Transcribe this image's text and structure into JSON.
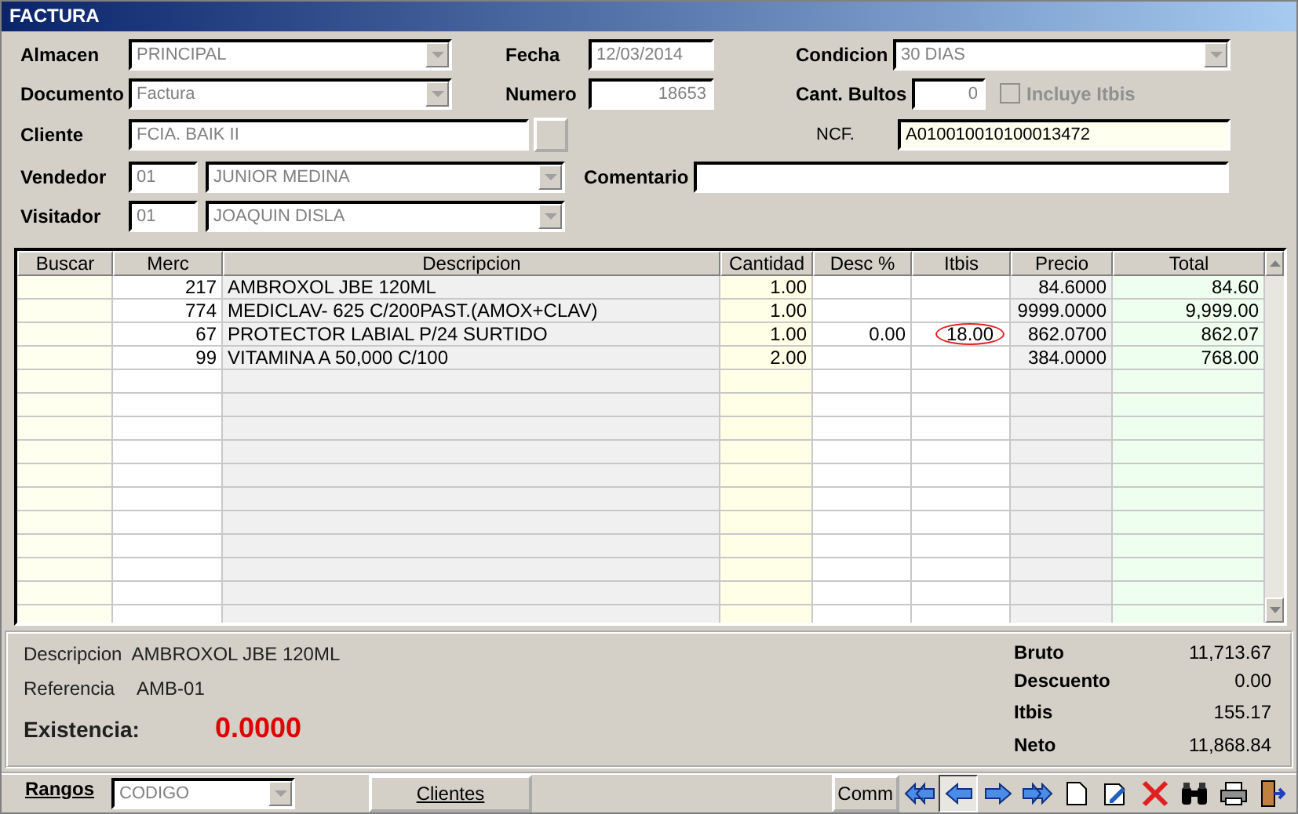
{
  "window": {
    "title": "FACTURA"
  },
  "form": {
    "almacen": {
      "label": "Almacen",
      "value": "PRINCIPAL"
    },
    "fecha": {
      "label": "Fecha",
      "value": "12/03/2014"
    },
    "condicion": {
      "label": "Condicion",
      "value": "30 DIAS"
    },
    "documento": {
      "label": "Documento",
      "value": "Factura"
    },
    "numero": {
      "label": "Numero",
      "value": "18653"
    },
    "cant_bultos": {
      "label": "Cant. Bultos",
      "value": "0"
    },
    "incluye_itbis": {
      "label": "Incluye Itbis",
      "checked": false,
      "disabled": true
    },
    "cliente": {
      "label": "Cliente",
      "value": "FCIA. BAIK II"
    },
    "ncf": {
      "label": "NCF.",
      "value": "A010010010100013472"
    },
    "vendedor": {
      "label": "Vendedor",
      "code": "01",
      "value": "JUNIOR MEDINA"
    },
    "comentario": {
      "label": "Comentario"
    },
    "visitador": {
      "label": "Visitador",
      "code": "01",
      "value": "JOAQUIN DISLA"
    }
  },
  "table": {
    "columns": [
      "Buscar",
      "Merc",
      "Descripcion",
      "Cantidad",
      "Desc %",
      "Itbis",
      "Precio",
      "Total"
    ],
    "rows": [
      {
        "merc": "217",
        "descripcion": "AMBROXOL JBE 120ML",
        "cantidad": "1.00",
        "desc": "",
        "itbis": "",
        "precio": "84.6000",
        "total": "84.60",
        "circled": false
      },
      {
        "merc": "774",
        "descripcion": "MEDICLAV- 625 C/200PAST.(AMOX+CLAV)",
        "cantidad": "1.00",
        "desc": "",
        "itbis": "",
        "precio": "9999.0000",
        "total": "9,999.00",
        "circled": false
      },
      {
        "merc": "67",
        "descripcion": "PROTECTOR LABIAL P/24 SURTIDO",
        "cantidad": "1.00",
        "desc": "0.00",
        "itbis": "18.00",
        "precio": "862.0700",
        "total": "862.07",
        "circled": true
      },
      {
        "merc": "99",
        "descripcion": "VITAMINA A 50,000 C/100",
        "cantidad": "2.00",
        "desc": "",
        "itbis": "",
        "precio": "384.0000",
        "total": "768.00",
        "circled": false
      }
    ]
  },
  "details": {
    "descripcion": {
      "label": "Descripcion",
      "value": "AMBROXOL JBE 120ML"
    },
    "referencia": {
      "label": "Referencia",
      "value": "AMB-01"
    },
    "existencia": {
      "label": "Existencia:",
      "value": "0.0000"
    }
  },
  "totals": [
    {
      "label": "Bruto",
      "value": "11,713.67"
    },
    {
      "label": "Descuento",
      "value": "0.00"
    },
    {
      "label": "Itbis",
      "value": "155.17"
    },
    {
      "label": "Neto",
      "value": "11,868.84"
    }
  ],
  "footer": {
    "rangos": {
      "label": "Rangos",
      "value": "CODIGO"
    },
    "clientes_button": "Clientes",
    "comm_button": "Comm",
    "tools": [
      {
        "kind": "first",
        "pressed": false
      },
      {
        "kind": "prev",
        "pressed": true
      },
      {
        "kind": "next",
        "pressed": false
      },
      {
        "kind": "last",
        "pressed": false
      },
      {
        "kind": "new",
        "pressed": false
      },
      {
        "kind": "edit",
        "pressed": false
      },
      {
        "kind": "delete",
        "pressed": false
      },
      {
        "kind": "find",
        "pressed": false
      },
      {
        "kind": "print",
        "pressed": false
      },
      {
        "kind": "exit",
        "pressed": false
      }
    ]
  }
}
